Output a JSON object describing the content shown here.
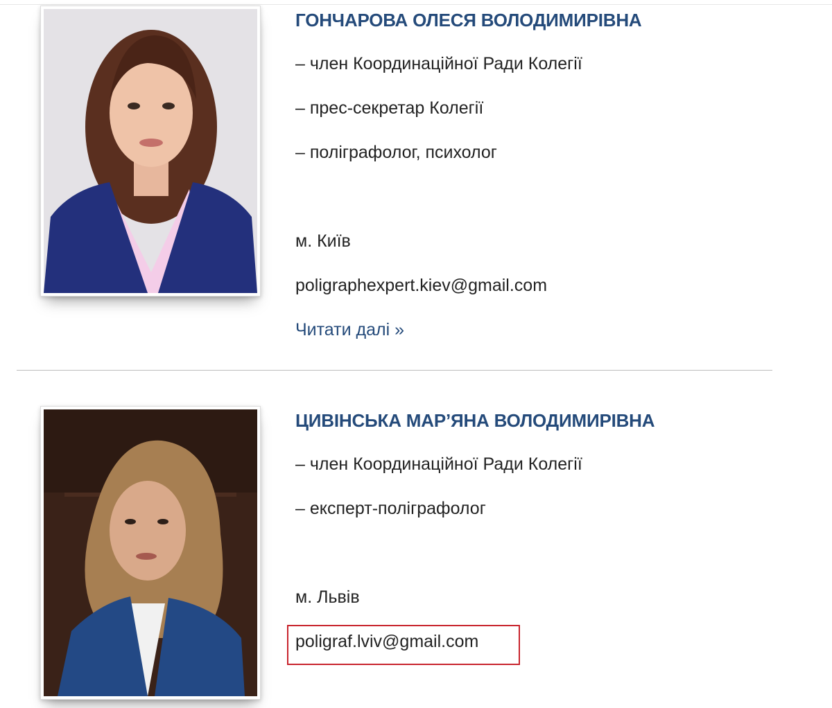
{
  "members": [
    {
      "name": "ГОНЧАРОВА ОЛЕСЯ ВОЛОДИМИРІВНА",
      "roles": [
        "– член Координаційної Ради Колегії",
        "– прес-секретар Колегії",
        "– поліграфолог, психолог"
      ],
      "city": "м. Київ",
      "email": "poligraphexpert.kiev@gmail.com",
      "read_more": "Читати далі »"
    },
    {
      "name": "ЦИВІНСЬКА МАР’ЯНА ВОЛОДИМИРІВНА",
      "roles": [
        "– член Координаційної Ради Колегії",
        "– експерт-поліграфолог"
      ],
      "city": "м. Львів",
      "email": "poligraf.lviv@gmail.com"
    }
  ],
  "colors": {
    "name_color": "#244a7a",
    "link_color": "#244a7a",
    "highlight_border": "#c8232c"
  }
}
